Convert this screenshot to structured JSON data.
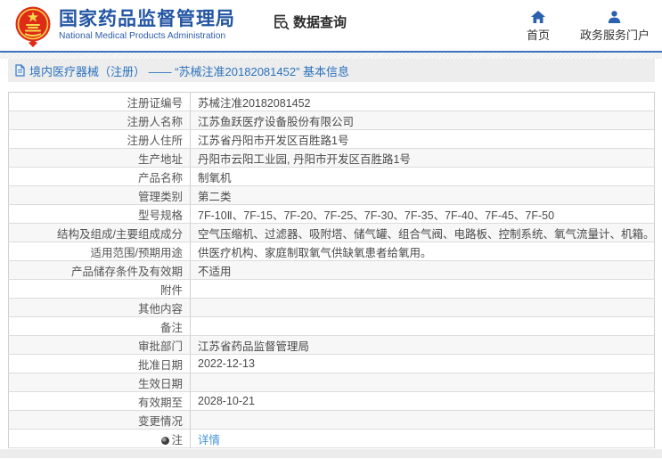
{
  "header": {
    "org_name_cn": "国家药品监督管理局",
    "org_name_en": "National Medical Products Administration",
    "data_query_label": "数据查询",
    "nav": [
      {
        "label": "首页",
        "icon": "home-icon"
      },
      {
        "label": "政务服务门户",
        "icon": "user-icon"
      }
    ]
  },
  "title_bar": {
    "text": "境内医疗器械（注册） —— “苏械注准20182081452” 基本信息"
  },
  "table": {
    "rows": [
      {
        "label": "注册证编号",
        "value": "苏械注准20182081452"
      },
      {
        "label": "注册人名称",
        "value": "江苏鱼跃医疗设备股份有限公司"
      },
      {
        "label": "注册人住所",
        "value": "江苏省丹阳市开发区百胜路1号"
      },
      {
        "label": "生产地址",
        "value": "丹阳市云阳工业园, 丹阳市开发区百胜路1号"
      },
      {
        "label": "产品名称",
        "value": "制氧机"
      },
      {
        "label": "管理类别",
        "value": "第二类"
      },
      {
        "label": "型号规格",
        "value": "7F-10Ⅱ、7F-15、7F-20、7F-25、7F-30、7F-35、7F-40、7F-45、7F-50"
      },
      {
        "label": "结构及组成/主要组成成分",
        "value": "空气压缩机、过滤器、吸附塔、储气罐、组合气阀、电路板、控制系统、氧气流量计、机箱。"
      },
      {
        "label": "适用范围/预期用途",
        "value": "供医疗机构、家庭制取氧气供缺氧患者给氧用。"
      },
      {
        "label": "产品储存条件及有效期",
        "value": "不适用"
      },
      {
        "label": "附件",
        "value": ""
      },
      {
        "label": "其他内容",
        "value": ""
      },
      {
        "label": "备注",
        "value": ""
      },
      {
        "label": "审批部门",
        "value": "江苏省药品监督管理局"
      },
      {
        "label": "批准日期",
        "value": "2022-12-13"
      },
      {
        "label": "生效日期",
        "value": ""
      },
      {
        "label": "有效期至",
        "value": "2028-10-21"
      },
      {
        "label": "变更情况",
        "value": ""
      },
      {
        "label": "注",
        "value": "详情",
        "link": true,
        "icon": "note-icon"
      }
    ]
  },
  "colors": {
    "accent_blue": "#2456a4",
    "title_blue": "#2b72bd",
    "link_blue": "#4293d9",
    "emblem_red": "#de2b18",
    "emblem_gold": "#f7d64a",
    "stripe_gray": "#f7f7f7",
    "border_gray": "#d0d0d0"
  }
}
